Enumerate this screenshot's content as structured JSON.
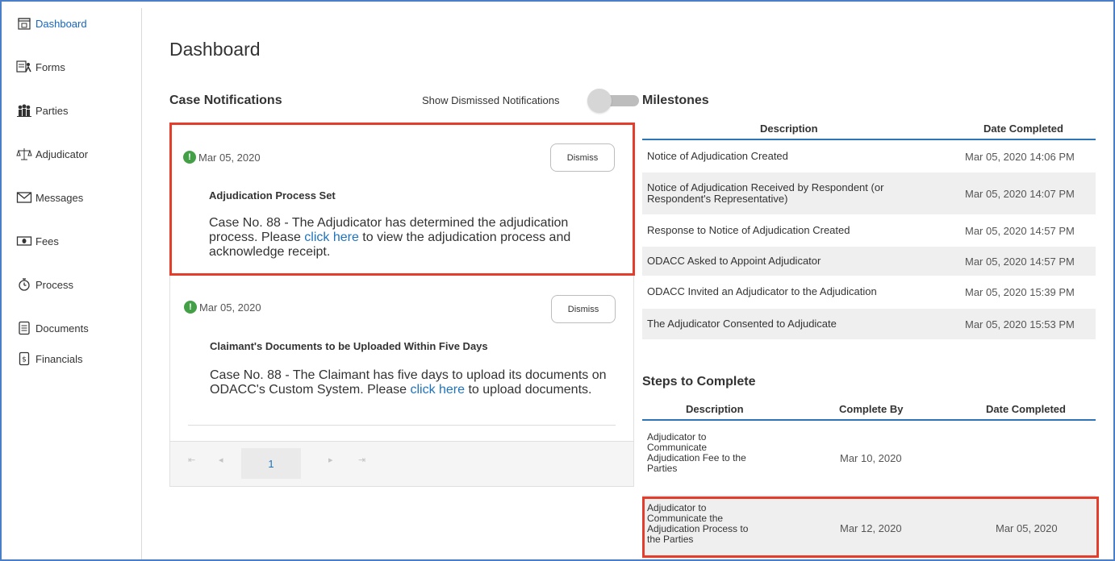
{
  "sidebar": {
    "items": [
      {
        "label": "Dashboard",
        "icon": "dashboard-icon",
        "active": true
      },
      {
        "label": "Forms",
        "icon": "forms-icon"
      },
      {
        "label": "Parties",
        "icon": "parties-icon"
      },
      {
        "label": "Adjudicator",
        "icon": "scales-icon"
      },
      {
        "label": "Messages",
        "icon": "envelope-icon"
      },
      {
        "label": "Fees",
        "icon": "banknote-icon"
      },
      {
        "label": "Process",
        "icon": "stopwatch-icon"
      },
      {
        "label": "Documents",
        "icon": "document-icon"
      },
      {
        "label": "Financials",
        "icon": "dollar-doc-icon"
      }
    ]
  },
  "page": {
    "title": "Dashboard"
  },
  "notifications": {
    "title": "Case Notifications",
    "toggle_label": "Show Dismissed Notifications",
    "toggle_on": false,
    "dismiss_label": "Dismiss",
    "items": [
      {
        "date": "Mar 05, 2020",
        "heading": "Adjudication Process Set",
        "body_before": "Case No. 88 - The Adjudicator has determined the adjudication process. Please ",
        "link": "click here",
        "body_after": " to view the adjudication process and acknowledge receipt."
      },
      {
        "date": "Mar 05, 2020",
        "heading": "Claimant's Documents to be Uploaded Within Five Days",
        "body_before": "Case No. 88 - The Claimant has five days to upload its documents on ODACC's Custom System. Please ",
        "link": "click here",
        "body_after": " to upload documents."
      }
    ],
    "pager": {
      "first": "⇤",
      "prev": "◂",
      "current": "1",
      "next": "▸",
      "last": "⇥"
    }
  },
  "milestones": {
    "title": "Milestones",
    "columns": [
      "Description",
      "Date Completed"
    ],
    "rows": [
      {
        "description": "Notice of Adjudication Created",
        "date": "Mar 05, 2020 14:06 PM"
      },
      {
        "description": "Notice of Adjudication Received by Respondent (or Respondent's Representative)",
        "date": "Mar 05, 2020 14:07 PM"
      },
      {
        "description": "Response to Notice of Adjudication Created",
        "date": "Mar 05, 2020 14:57 PM"
      },
      {
        "description": "ODACC Asked to Appoint Adjudicator",
        "date": "Mar 05, 2020 14:57 PM"
      },
      {
        "description": "ODACC Invited an Adjudicator to the Adjudication",
        "date": "Mar 05, 2020 15:39 PM"
      },
      {
        "description": "The Adjudicator Consented to Adjudicate",
        "date": "Mar 05, 2020 15:53 PM"
      }
    ]
  },
  "steps": {
    "title": "Steps to Complete",
    "columns": [
      "Description",
      "Complete By",
      "Date Completed"
    ],
    "rows": [
      {
        "description": "Adjudicator to Communicate Adjudication Fee to the Parties",
        "complete_by": "Mar 10, 2020",
        "date_completed": ""
      },
      {
        "description": "Adjudicator to Communicate the Adjudication Process to the Parties",
        "complete_by": "Mar 12, 2020",
        "date_completed": "Mar 05, 2020"
      }
    ]
  },
  "colors": {
    "accent": "#1565c0",
    "link": "#1e73be",
    "highlight": "#e53d2c",
    "table_rule": "#2e75b6",
    "status_ok": "#43a047"
  }
}
